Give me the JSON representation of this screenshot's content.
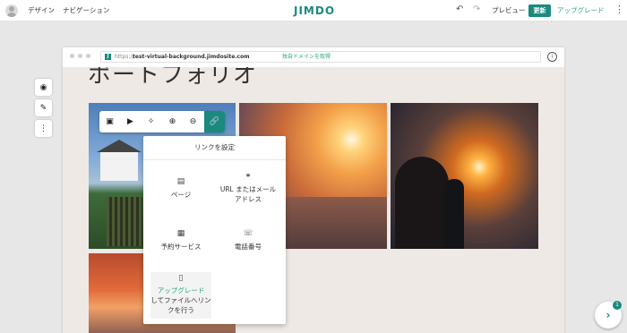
{
  "topbar": {
    "design": "デザイン",
    "navigation": "ナビゲーション",
    "logo": "JIMDO",
    "preview": "プレビュー",
    "update": "更新",
    "upgrade": "アップグレード"
  },
  "browser": {
    "url_protocol": "https://",
    "url_domain": "test-virtual-background.jimdosite.com",
    "domain_cta": "独自ドメインを取得"
  },
  "page": {
    "title": "ポートフォリオ"
  },
  "link_popup": {
    "title": "リンクを設定",
    "options": {
      "page": "ページ",
      "url_email": "URL またはメール アドレス",
      "booking": "予約サービス",
      "phone": "電話番号",
      "upgrade_highlight": "アップグレード",
      "upgrade_rest": "してファイルへリンクを行う"
    }
  },
  "help": {
    "badge_count": "1"
  },
  "icons": {
    "user": "avatar",
    "undo": "undo-icon",
    "redo": "redo-icon",
    "more": "kebab-icon",
    "eye": "eye-icon",
    "paint": "paint-icon",
    "image": "image-icon",
    "play": "play-icon",
    "magic": "magic-wand-icon",
    "zoom_in": "zoom-in-icon",
    "zoom_out": "zoom-out-icon",
    "link": "link-icon",
    "info": "info-icon",
    "chevron": "chevron-right-icon"
  },
  "colors": {
    "brand": "#1a8a7e",
    "upgrade": "#2ca67f"
  }
}
